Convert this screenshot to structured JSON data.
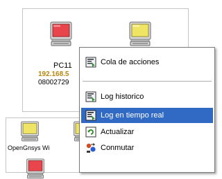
{
  "computers": {
    "pc11": {
      "name": "PC11",
      "ip": "192.168.5",
      "mac": "08002729"
    },
    "opengnsys": {
      "name": "OpenGnsys Wi"
    }
  },
  "context_menu": {
    "items": [
      {
        "label": "Cola de acciones",
        "icon": "task-queue-icon"
      },
      {
        "label": "Log historico",
        "icon": "log-history-icon"
      },
      {
        "label": "Log en tiempo real",
        "icon": "log-realtime-icon",
        "highlighted": true
      },
      {
        "label": "Actualizar",
        "icon": "refresh-icon"
      },
      {
        "label": "Conmutar",
        "icon": "switch-icon"
      }
    ]
  },
  "colors": {
    "menu_highlight": "#316ac5",
    "ip_text": "#b8860b",
    "monitor_red": "#e8454c",
    "monitor_yellow": "#efe463"
  }
}
